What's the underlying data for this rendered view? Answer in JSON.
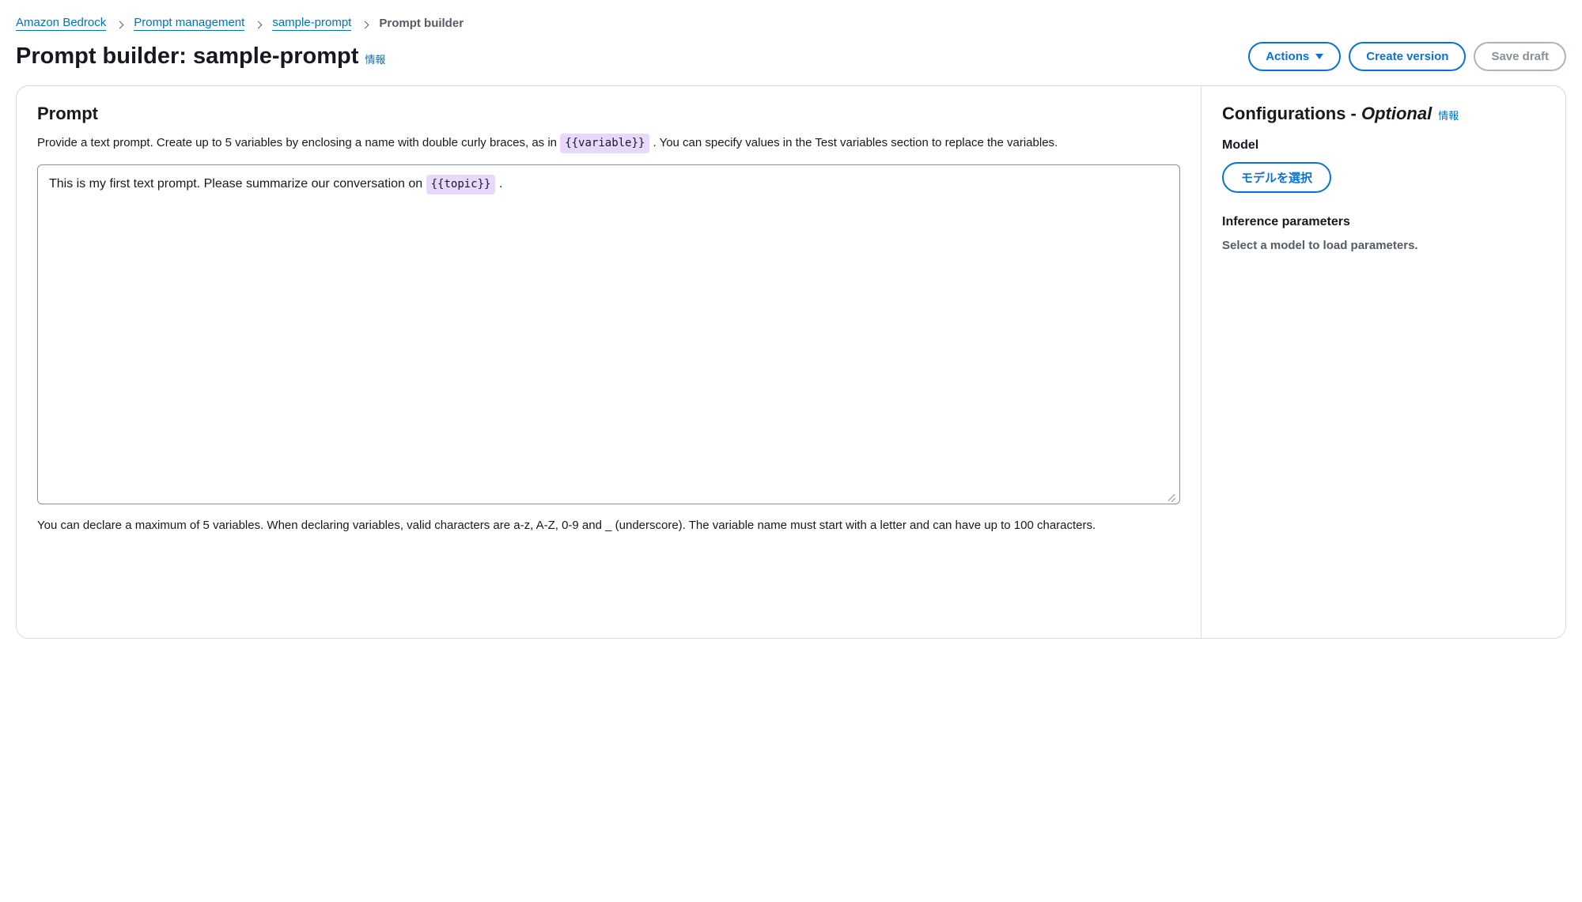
{
  "breadcrumb": {
    "items": [
      {
        "label": "Amazon Bedrock",
        "link": true
      },
      {
        "label": "Prompt management",
        "link": true
      },
      {
        "label": "sample-prompt",
        "link": true
      },
      {
        "label": "Prompt builder",
        "link": false
      }
    ]
  },
  "header": {
    "title": "Prompt builder: sample-prompt",
    "info_label": "情報",
    "actions": {
      "actions_label": "Actions",
      "create_version_label": "Create version",
      "save_draft_label": "Save draft"
    }
  },
  "prompt_panel": {
    "title": "Prompt",
    "desc_pre": "Provide a text prompt. Create up to 5 variables by enclosing a name with double curly braces, as in ",
    "desc_var_example": "{{variable}}",
    "desc_post": " . You can specify values in the Test variables section to replace the variables.",
    "editor_text_pre": "This is my first text prompt. Please summarize our conversation on ",
    "editor_var": "{{topic}}",
    "editor_text_post": " .",
    "hint": "You can declare a maximum of 5 variables. When declaring variables, valid characters are a-z, A-Z, 0-9 and _ (underscore). The variable name must start with a letter and can have up to 100 characters."
  },
  "config_panel": {
    "title_main": "Configurations - ",
    "title_optional": "Optional",
    "info_label": "情報",
    "model_heading": "Model",
    "model_button": "モデルを選択",
    "inference_heading": "Inference parameters",
    "inference_msg": "Select a model to load parameters."
  }
}
